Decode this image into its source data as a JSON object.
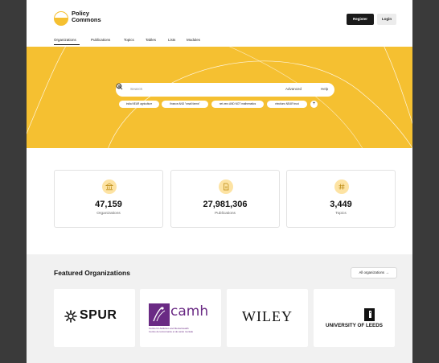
{
  "brand": {
    "line1": "Policy",
    "line2": "Commons"
  },
  "header": {
    "register_label": "Register",
    "login_label": "Login"
  },
  "nav": [
    {
      "label": "Organizations"
    },
    {
      "label": "Publications"
    },
    {
      "label": "Topics"
    },
    {
      "label": "Tables"
    },
    {
      "label": "Lists"
    },
    {
      "label": "Modules"
    }
  ],
  "search": {
    "placeholder": "Search",
    "advanced_label": "Advanced",
    "help_label": "Help"
  },
  "chips": [
    {
      "label": "india NEAR agriculture"
    },
    {
      "label": "finance AND \"small farms\""
    },
    {
      "label": "net zero AND NOT mathematics"
    },
    {
      "label": "elections NEAR trust"
    }
  ],
  "chip_more": "+",
  "stats": [
    {
      "value": "47,159",
      "label": "Organizations",
      "icon": "building-icon"
    },
    {
      "value": "27,981,306",
      "label": "Publications",
      "icon": "document-icon"
    },
    {
      "value": "3,449",
      "label": "Topics",
      "icon": "hash-icon"
    }
  ],
  "featured": {
    "title": "Featured Organizations",
    "all_label": "All organizations →",
    "orgs": [
      {
        "name": "SPUR"
      },
      {
        "name": "camh",
        "subtitle_en": "Centre for Addiction and Mental Health",
        "subtitle_fr": "Centre de toxicomanie et de santé mentale"
      },
      {
        "name": "WILEY"
      },
      {
        "name": "UNIVERSITY OF LEEDS"
      }
    ]
  },
  "colors": {
    "accent": "#f5c031",
    "icon_bg": "#fde3a3",
    "camh": "#6a2a84"
  }
}
